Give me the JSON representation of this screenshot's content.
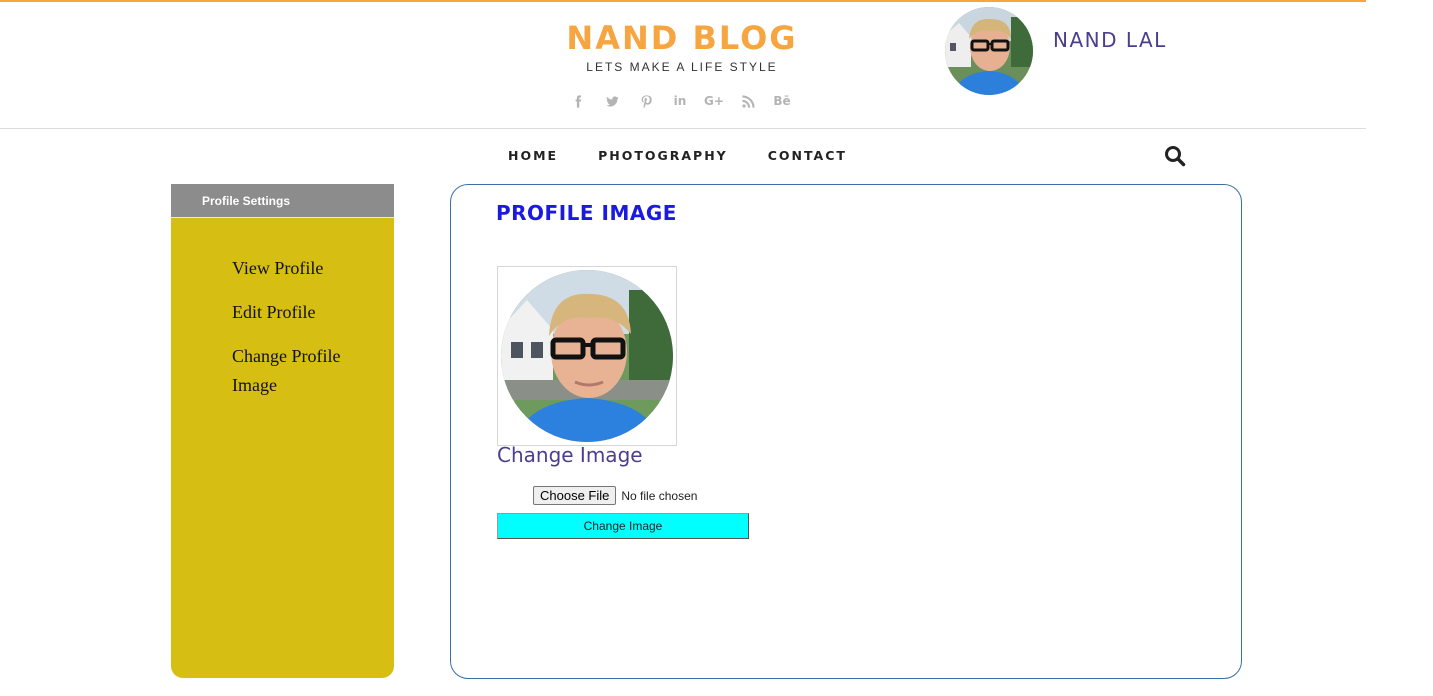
{
  "brand": {
    "title": "NAND BLOG",
    "tagline": "LETS MAKE A LIFE STYLE"
  },
  "social": [
    "facebook-icon",
    "twitter-icon",
    "pinterest-icon",
    "linkedin-icon",
    "google-plus-icon",
    "rss-icon",
    "behance-icon"
  ],
  "social_text": {
    "linkedin": "in",
    "google_plus": "G+",
    "behance": "Bē"
  },
  "user": {
    "name": "NAND LAL"
  },
  "nav": {
    "home": "HOME",
    "photography": "PHOTOGRAPHY",
    "contact": "CONTACT"
  },
  "sidebar": {
    "heading": "Profile Settings",
    "items": [
      {
        "label": "View Profile"
      },
      {
        "label": "Edit Profile"
      },
      {
        "label": "Change Profile Image"
      }
    ]
  },
  "main": {
    "title": "PROFILE IMAGE",
    "change_label": "Change Image",
    "file_button": "Choose File",
    "file_status": "No file chosen",
    "submit_label": "Change Image"
  },
  "colors": {
    "accent": "#f6a540",
    "sidebar": "#d6be12",
    "title": "#1a1ae0",
    "submit": "#00ffff"
  }
}
